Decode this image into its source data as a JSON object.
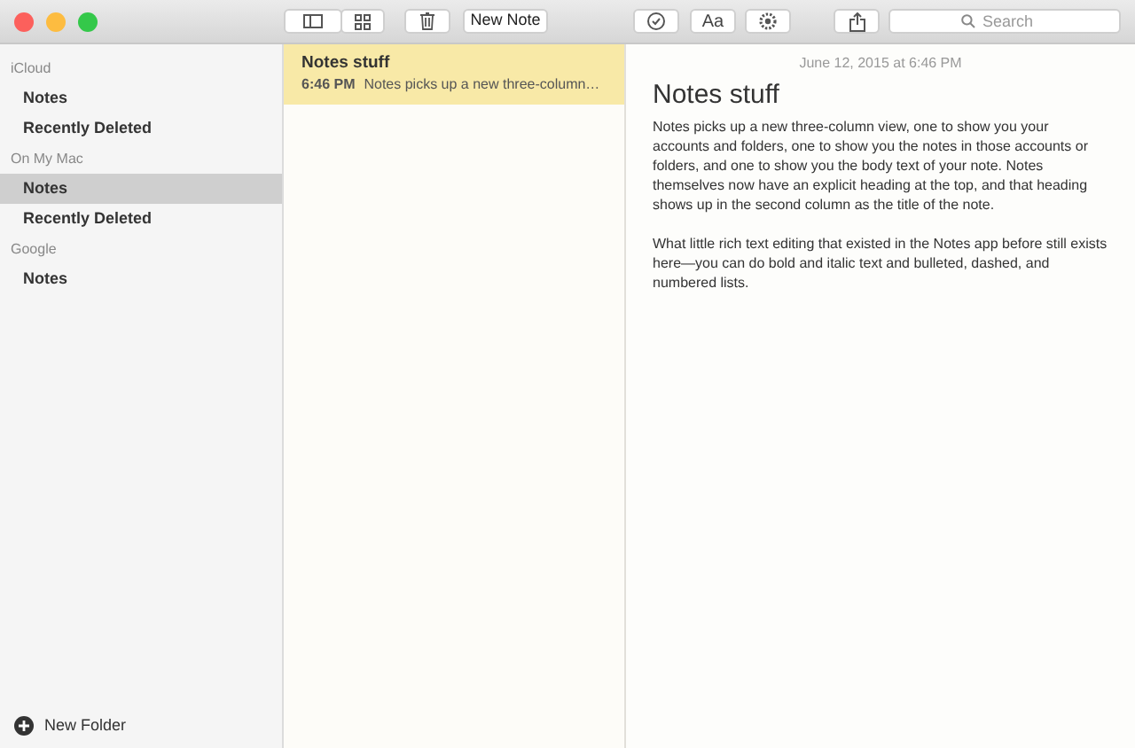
{
  "toolbar": {
    "new_note": "New Note",
    "format": "Aa",
    "search": {
      "placeholder": "Search"
    }
  },
  "sidebar": {
    "sections": [
      {
        "title": "iCloud",
        "items": [
          {
            "label": "Notes",
            "selected": false
          },
          {
            "label": "Recently Deleted",
            "selected": false
          }
        ]
      },
      {
        "title": "On My Mac",
        "items": [
          {
            "label": "Notes",
            "selected": true
          },
          {
            "label": "Recently Deleted",
            "selected": false
          }
        ]
      },
      {
        "title": "Google",
        "items": [
          {
            "label": "Notes",
            "selected": false
          }
        ]
      }
    ],
    "new_folder": "New Folder"
  },
  "notes_list": [
    {
      "title": "Notes stuff",
      "time": "6:46 PM",
      "preview": "Notes picks up a new three-column…",
      "selected": true
    }
  ],
  "editor": {
    "date": "June 12, 2015 at 6:46 PM",
    "title": "Notes stuff",
    "paragraphs": [
      "Notes picks up a new three-column view, one to show you your accounts and folders, one to show you the notes in those accounts or folders, and one to show you the body text of your note. Notes themselves now have an explicit heading at the top, and that heading shows up in the second column as the title of the note.",
      "What little rich text editing that existed in the Notes app before still exists here—you can do bold and italic text and bulleted, dashed, and numbered lists."
    ]
  }
}
